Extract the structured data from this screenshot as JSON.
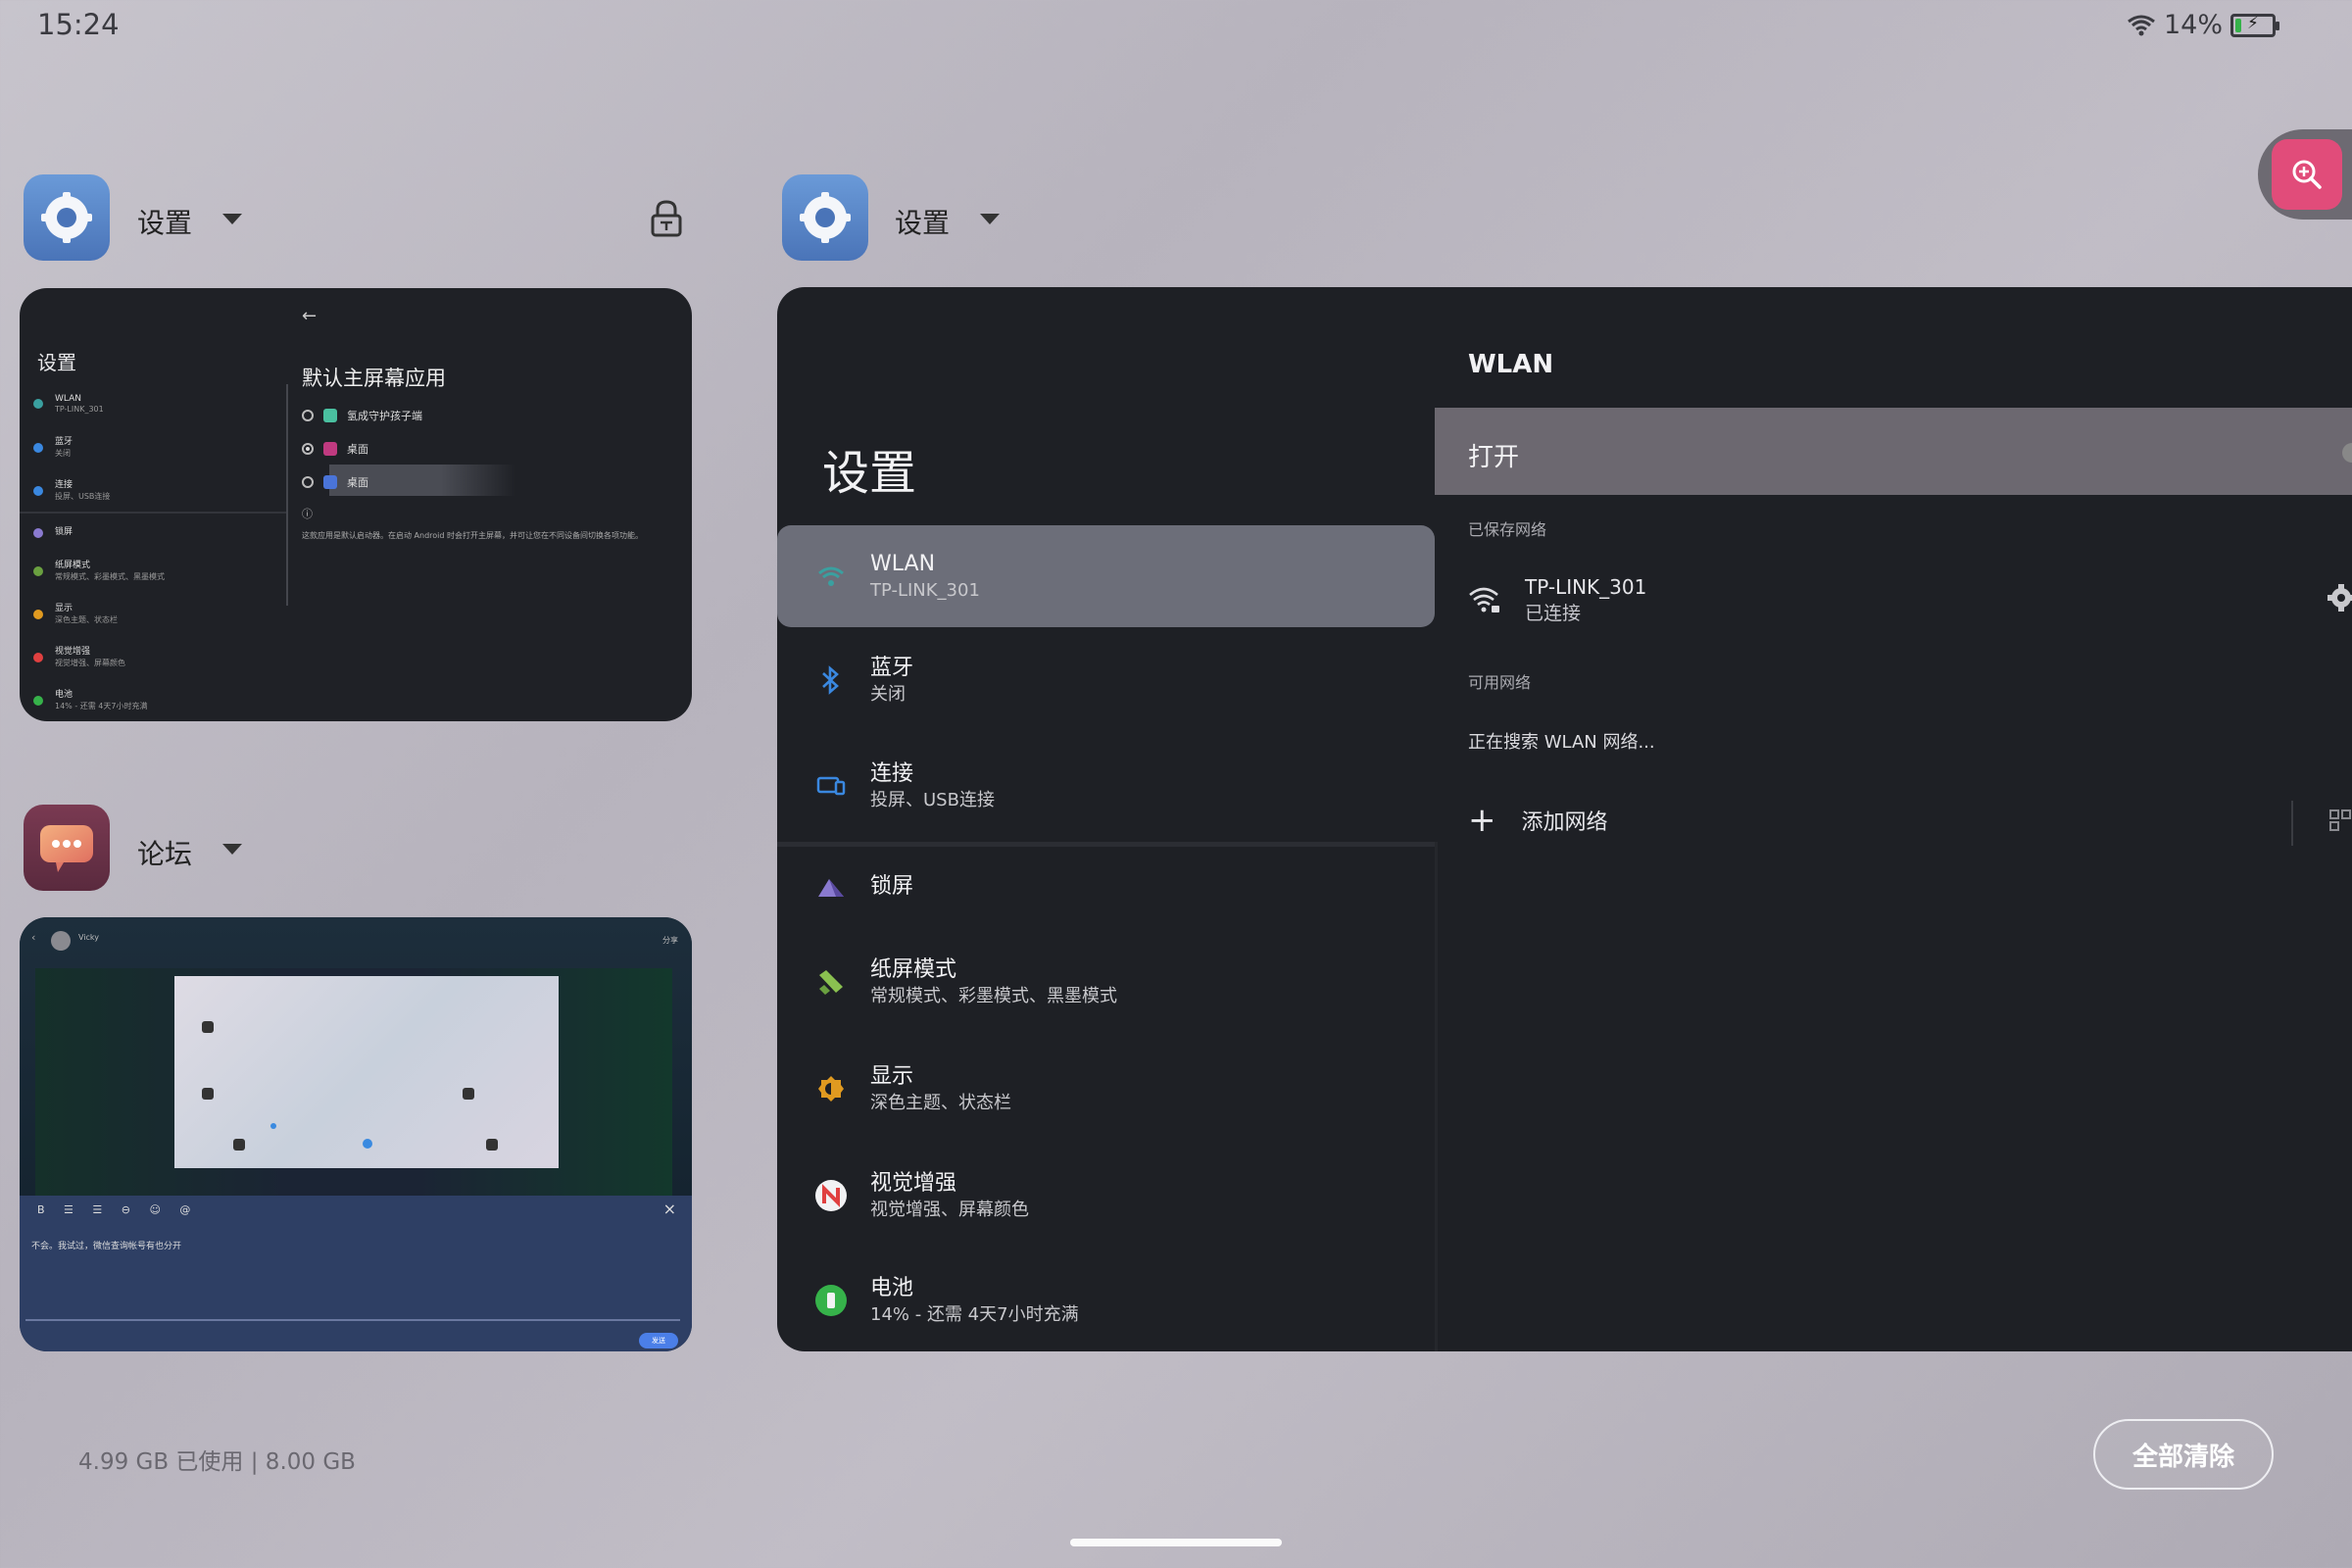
{
  "status": {
    "time": "15:24",
    "battery_percent": "14%",
    "battery_level": 0.14,
    "battery_color": "#36b24a"
  },
  "zoom_button": {
    "icon": "zoom-in-icon",
    "color": "#e14c7a"
  },
  "recent_apps": [
    {
      "name": "设置",
      "icon": "settings-app-icon",
      "lock_icon": "lock-icon"
    },
    {
      "name": "论坛",
      "icon": "forum-app-icon"
    },
    {
      "name": "设置",
      "icon": "settings-app-icon"
    }
  ],
  "thumb_settings": {
    "title": "设置",
    "items": [
      {
        "label": "WLAN",
        "sub": "TP-LINK_301",
        "color": "#3aa0a0"
      },
      {
        "label": "蓝牙",
        "sub": "关闭",
        "color": "#3a88e0"
      },
      {
        "label": "连接",
        "sub": "投屏、USB连接",
        "color": "#3a88e0"
      },
      {
        "label": "锁屏",
        "sub": "",
        "color": "#8a7ad0"
      },
      {
        "label": "纸屏模式",
        "sub": "常规模式、彩墨模式、黑墨模式",
        "color": "#6aa040"
      },
      {
        "label": "显示",
        "sub": "深色主题、状态栏",
        "color": "#e09a20"
      },
      {
        "label": "视觉增强",
        "sub": "视觉增强、屏幕颜色",
        "color": "#e04040"
      },
      {
        "label": "电池",
        "sub": "14% - 还需 4天7小时充满",
        "color": "#36b24a"
      }
    ],
    "detail_title": "默认主屏幕应用",
    "options": [
      {
        "label": "氢成守护孩子端",
        "selected": false,
        "color": "#4ac0a0"
      },
      {
        "label": "桌面",
        "selected": true,
        "color": "#c03a80"
      },
      {
        "label": "桌面",
        "selected": false,
        "color": "#4a74d8"
      }
    ],
    "note": "这款应用是默认启动器。在启动 Android 时会打开主屏幕，并可让您在不同设备间切换各项功能。"
  },
  "thumb_forum": {
    "user": "Vicky",
    "share": "分享",
    "toolbar": "B ☰ ☰ ⊖   ☺ @",
    "text": "不会。我试过，微信查询帐号有也分开",
    "send": "发送"
  },
  "settings_window": {
    "title": "设置",
    "items": [
      {
        "label": "WLAN",
        "sub": "TP-LINK_301",
        "icon": "wifi-icon",
        "color": "#3aa0a0"
      },
      {
        "label": "蓝牙",
        "sub": "关闭",
        "icon": "bluetooth-icon",
        "color": "#3a88e0"
      },
      {
        "label": "连接",
        "sub": "投屏、USB连接",
        "icon": "cast-icon",
        "color": "#3a88e0"
      },
      {
        "label": "锁屏",
        "sub": "",
        "icon": "lock-screen-icon",
        "color": "#8a7ad0"
      },
      {
        "label": "纸屏模式",
        "sub": "常规模式、彩墨模式、黑墨模式",
        "icon": "paper-mode-icon",
        "color": "#8ac050"
      },
      {
        "label": "显示",
        "sub": "深色主题、状态栏",
        "icon": "display-icon",
        "color": "#e09a20"
      },
      {
        "label": "视觉增强",
        "sub": "视觉增强、屏幕颜色",
        "icon": "vision-icon",
        "color": "#e04040"
      },
      {
        "label": "电池",
        "sub": "14% - 还需 4天7小时充满",
        "icon": "battery-icon",
        "color": "#36b24a"
      }
    ],
    "wlan": {
      "title": "WLAN",
      "toggle_label": "打开",
      "saved_header": "已保存网络",
      "saved_network": {
        "name": "TP-LINK_301",
        "status": "已连接"
      },
      "available_header": "可用网络",
      "searching": "正在搜索 WLAN 网络...",
      "add_network": "添加网络"
    }
  },
  "footer": {
    "memory": "4.99 GB 已使用 | 8.00 GB",
    "clear_all": "全部清除"
  }
}
